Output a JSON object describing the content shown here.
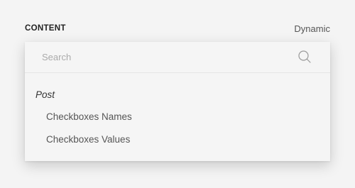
{
  "header": {
    "section_label": "CONTENT",
    "mode_label": "Dynamic"
  },
  "dropdown": {
    "search": {
      "placeholder": "Search",
      "value": "",
      "icon": "search-icon"
    },
    "groups": [
      {
        "label": "Post",
        "options": [
          {
            "label": "Checkboxes Names"
          },
          {
            "label": "Checkboxes Values"
          }
        ]
      }
    ]
  }
}
